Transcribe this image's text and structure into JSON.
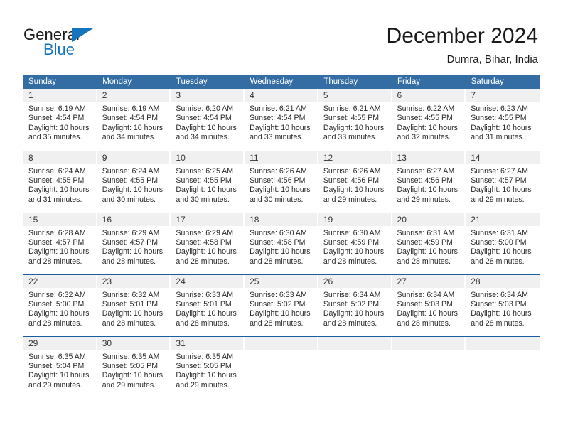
{
  "brand": {
    "name_top": "General",
    "name_bottom": "Blue",
    "accent_color": "#1574bb"
  },
  "header": {
    "title": "December 2024",
    "subtitle": "Dumra, Bihar, India"
  },
  "theme": {
    "header_row_bg": "#336da4",
    "week_divider": "#1b5d9e",
    "daynum_bg": "#f0f0f0"
  },
  "weekdays": [
    "Sunday",
    "Monday",
    "Tuesday",
    "Wednesday",
    "Thursday",
    "Friday",
    "Saturday"
  ],
  "weeks": [
    [
      {
        "day": "1",
        "sunrise": "Sunrise: 6:19 AM",
        "sunset": "Sunset: 4:54 PM",
        "daylight_line1": "Daylight: 10 hours",
        "daylight_line2": "and 35 minutes."
      },
      {
        "day": "2",
        "sunrise": "Sunrise: 6:19 AM",
        "sunset": "Sunset: 4:54 PM",
        "daylight_line1": "Daylight: 10 hours",
        "daylight_line2": "and 34 minutes."
      },
      {
        "day": "3",
        "sunrise": "Sunrise: 6:20 AM",
        "sunset": "Sunset: 4:54 PM",
        "daylight_line1": "Daylight: 10 hours",
        "daylight_line2": "and 34 minutes."
      },
      {
        "day": "4",
        "sunrise": "Sunrise: 6:21 AM",
        "sunset": "Sunset: 4:54 PM",
        "daylight_line1": "Daylight: 10 hours",
        "daylight_line2": "and 33 minutes."
      },
      {
        "day": "5",
        "sunrise": "Sunrise: 6:21 AM",
        "sunset": "Sunset: 4:55 PM",
        "daylight_line1": "Daylight: 10 hours",
        "daylight_line2": "and 33 minutes."
      },
      {
        "day": "6",
        "sunrise": "Sunrise: 6:22 AM",
        "sunset": "Sunset: 4:55 PM",
        "daylight_line1": "Daylight: 10 hours",
        "daylight_line2": "and 32 minutes."
      },
      {
        "day": "7",
        "sunrise": "Sunrise: 6:23 AM",
        "sunset": "Sunset: 4:55 PM",
        "daylight_line1": "Daylight: 10 hours",
        "daylight_line2": "and 31 minutes."
      }
    ],
    [
      {
        "day": "8",
        "sunrise": "Sunrise: 6:24 AM",
        "sunset": "Sunset: 4:55 PM",
        "daylight_line1": "Daylight: 10 hours",
        "daylight_line2": "and 31 minutes."
      },
      {
        "day": "9",
        "sunrise": "Sunrise: 6:24 AM",
        "sunset": "Sunset: 4:55 PM",
        "daylight_line1": "Daylight: 10 hours",
        "daylight_line2": "and 30 minutes."
      },
      {
        "day": "10",
        "sunrise": "Sunrise: 6:25 AM",
        "sunset": "Sunset: 4:55 PM",
        "daylight_line1": "Daylight: 10 hours",
        "daylight_line2": "and 30 minutes."
      },
      {
        "day": "11",
        "sunrise": "Sunrise: 6:26 AM",
        "sunset": "Sunset: 4:56 PM",
        "daylight_line1": "Daylight: 10 hours",
        "daylight_line2": "and 30 minutes."
      },
      {
        "day": "12",
        "sunrise": "Sunrise: 6:26 AM",
        "sunset": "Sunset: 4:56 PM",
        "daylight_line1": "Daylight: 10 hours",
        "daylight_line2": "and 29 minutes."
      },
      {
        "day": "13",
        "sunrise": "Sunrise: 6:27 AM",
        "sunset": "Sunset: 4:56 PM",
        "daylight_line1": "Daylight: 10 hours",
        "daylight_line2": "and 29 minutes."
      },
      {
        "day": "14",
        "sunrise": "Sunrise: 6:27 AM",
        "sunset": "Sunset: 4:57 PM",
        "daylight_line1": "Daylight: 10 hours",
        "daylight_line2": "and 29 minutes."
      }
    ],
    [
      {
        "day": "15",
        "sunrise": "Sunrise: 6:28 AM",
        "sunset": "Sunset: 4:57 PM",
        "daylight_line1": "Daylight: 10 hours",
        "daylight_line2": "and 28 minutes."
      },
      {
        "day": "16",
        "sunrise": "Sunrise: 6:29 AM",
        "sunset": "Sunset: 4:57 PM",
        "daylight_line1": "Daylight: 10 hours",
        "daylight_line2": "and 28 minutes."
      },
      {
        "day": "17",
        "sunrise": "Sunrise: 6:29 AM",
        "sunset": "Sunset: 4:58 PM",
        "daylight_line1": "Daylight: 10 hours",
        "daylight_line2": "and 28 minutes."
      },
      {
        "day": "18",
        "sunrise": "Sunrise: 6:30 AM",
        "sunset": "Sunset: 4:58 PM",
        "daylight_line1": "Daylight: 10 hours",
        "daylight_line2": "and 28 minutes."
      },
      {
        "day": "19",
        "sunrise": "Sunrise: 6:30 AM",
        "sunset": "Sunset: 4:59 PM",
        "daylight_line1": "Daylight: 10 hours",
        "daylight_line2": "and 28 minutes."
      },
      {
        "day": "20",
        "sunrise": "Sunrise: 6:31 AM",
        "sunset": "Sunset: 4:59 PM",
        "daylight_line1": "Daylight: 10 hours",
        "daylight_line2": "and 28 minutes."
      },
      {
        "day": "21",
        "sunrise": "Sunrise: 6:31 AM",
        "sunset": "Sunset: 5:00 PM",
        "daylight_line1": "Daylight: 10 hours",
        "daylight_line2": "and 28 minutes."
      }
    ],
    [
      {
        "day": "22",
        "sunrise": "Sunrise: 6:32 AM",
        "sunset": "Sunset: 5:00 PM",
        "daylight_line1": "Daylight: 10 hours",
        "daylight_line2": "and 28 minutes."
      },
      {
        "day": "23",
        "sunrise": "Sunrise: 6:32 AM",
        "sunset": "Sunset: 5:01 PM",
        "daylight_line1": "Daylight: 10 hours",
        "daylight_line2": "and 28 minutes."
      },
      {
        "day": "24",
        "sunrise": "Sunrise: 6:33 AM",
        "sunset": "Sunset: 5:01 PM",
        "daylight_line1": "Daylight: 10 hours",
        "daylight_line2": "and 28 minutes."
      },
      {
        "day": "25",
        "sunrise": "Sunrise: 6:33 AM",
        "sunset": "Sunset: 5:02 PM",
        "daylight_line1": "Daylight: 10 hours",
        "daylight_line2": "and 28 minutes."
      },
      {
        "day": "26",
        "sunrise": "Sunrise: 6:34 AM",
        "sunset": "Sunset: 5:02 PM",
        "daylight_line1": "Daylight: 10 hours",
        "daylight_line2": "and 28 minutes."
      },
      {
        "day": "27",
        "sunrise": "Sunrise: 6:34 AM",
        "sunset": "Sunset: 5:03 PM",
        "daylight_line1": "Daylight: 10 hours",
        "daylight_line2": "and 28 minutes."
      },
      {
        "day": "28",
        "sunrise": "Sunrise: 6:34 AM",
        "sunset": "Sunset: 5:03 PM",
        "daylight_line1": "Daylight: 10 hours",
        "daylight_line2": "and 28 minutes."
      }
    ],
    [
      {
        "day": "29",
        "sunrise": "Sunrise: 6:35 AM",
        "sunset": "Sunset: 5:04 PM",
        "daylight_line1": "Daylight: 10 hours",
        "daylight_line2": "and 29 minutes."
      },
      {
        "day": "30",
        "sunrise": "Sunrise: 6:35 AM",
        "sunset": "Sunset: 5:05 PM",
        "daylight_line1": "Daylight: 10 hours",
        "daylight_line2": "and 29 minutes."
      },
      {
        "day": "31",
        "sunrise": "Sunrise: 6:35 AM",
        "sunset": "Sunset: 5:05 PM",
        "daylight_line1": "Daylight: 10 hours",
        "daylight_line2": "and 29 minutes."
      },
      {
        "day": "",
        "sunrise": "",
        "sunset": "",
        "daylight_line1": "",
        "daylight_line2": ""
      },
      {
        "day": "",
        "sunrise": "",
        "sunset": "",
        "daylight_line1": "",
        "daylight_line2": ""
      },
      {
        "day": "",
        "sunrise": "",
        "sunset": "",
        "daylight_line1": "",
        "daylight_line2": ""
      },
      {
        "day": "",
        "sunrise": "",
        "sunset": "",
        "daylight_line1": "",
        "daylight_line2": ""
      }
    ]
  ]
}
